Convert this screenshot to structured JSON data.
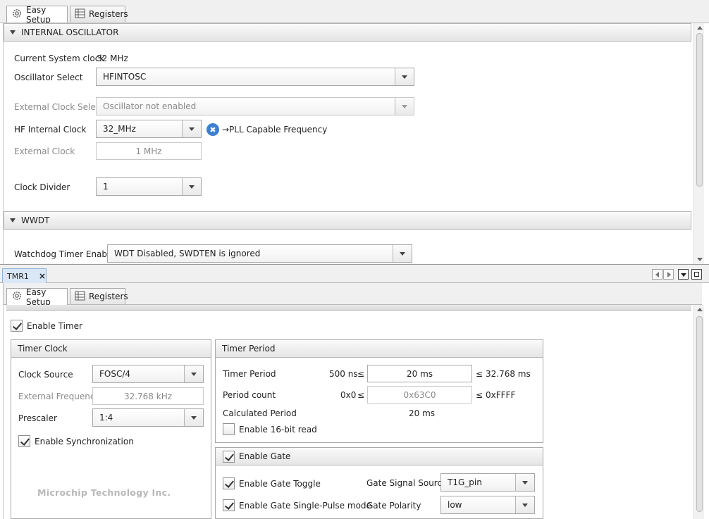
{
  "top_tabs": [
    {
      "label": "Easy Setup",
      "icon": "gear-icon"
    },
    {
      "label": "Registers",
      "icon": "register-table-icon"
    }
  ],
  "internal_oscillator": {
    "header": "INTERNAL OSCILLATOR",
    "current_clock_label": "Current System clock",
    "current_clock_value": "32 MHz",
    "osc_select_label": "Oscillator Select",
    "osc_select_value": "HFINTOSC",
    "ext_clock_select_label": "External Clock Select",
    "ext_clock_select_value": "Oscillator not enabled",
    "hf_internal_label": "HF Internal Clock",
    "hf_internal_value": "32_MHz",
    "pll_text": "→PLL Capable Frequency",
    "ext_clock_label": "External Clock",
    "ext_clock_value": "1 MHz",
    "clock_divider_label": "Clock Divider",
    "clock_divider_value": "1"
  },
  "wwdt": {
    "header": "WWDT",
    "wdt_enable_label": "Watchdog Timer Enable",
    "wdt_enable_value": "WDT Disabled, SWDTEN is ignored"
  },
  "editor_tab": {
    "label": "TMR1",
    "close": "×"
  },
  "bottom_tabs": [
    {
      "label": "Easy Setup",
      "icon": "gear-icon"
    },
    {
      "label": "Registers",
      "icon": "register-table-icon"
    }
  ],
  "tmr1": {
    "enable_timer_label": "Enable Timer",
    "timer_clock": {
      "header": "Timer Clock",
      "clock_source_label": "Clock Source",
      "clock_source_value": "FOSC/4",
      "ext_freq_label": "External Frequency",
      "ext_freq_value": "32.768 kHz",
      "prescaler_label": "Prescaler",
      "prescaler_value": "1:4",
      "sync_label": "Enable Synchronization"
    },
    "timer_period": {
      "header": "Timer Period",
      "period_label": "Timer Period",
      "period_min": "500 ns",
      "period_value": "20 ms",
      "period_max": "32.768 ms",
      "count_label": "Period count",
      "count_min": "0x0",
      "count_value": "0x63C0",
      "count_max": "0xFFFF",
      "calc_label": "Calculated Period",
      "calc_value": "20 ms",
      "read16_label": "Enable 16-bit read",
      "le": "≤"
    },
    "gate": {
      "header": "Enable Gate",
      "toggle_label": "Enable Gate Toggle",
      "single_pulse_label": "Enable Gate Single-Pulse mode",
      "signal_source_label": "Gate Signal Source",
      "signal_source_value": "T1G_pin",
      "polarity_label": "Gate Polarity",
      "polarity_value": "low"
    },
    "watermark": "Microchip Technology Inc."
  },
  "colors": {
    "pll_badge": "#3d7fd1",
    "tab_active_bg": "#ffffff",
    "panel_bg": "#f0f0f0"
  }
}
